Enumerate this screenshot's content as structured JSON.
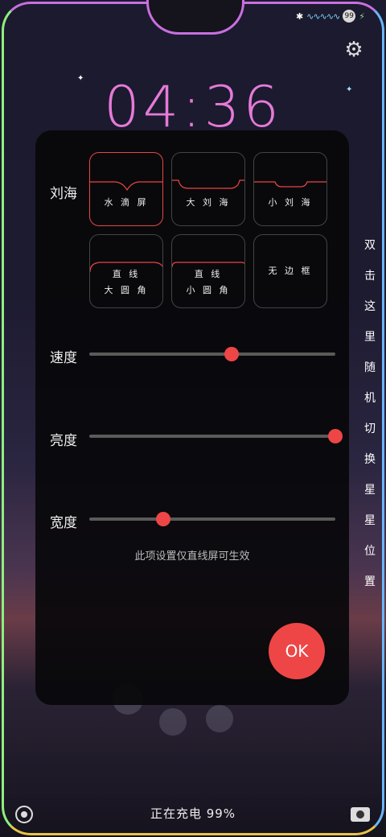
{
  "status_bar": {
    "battery_badge": "99",
    "wave": "∿∿∿∿∿"
  },
  "clock": {
    "time": "04:36"
  },
  "side_hint": [
    "双",
    "击",
    "这",
    "里",
    "随",
    "机",
    "切",
    "换",
    "星",
    "星",
    "位",
    "置"
  ],
  "panel": {
    "notch_label": "刘海",
    "options": [
      {
        "line1": "水 滴 屏",
        "line2": ""
      },
      {
        "line1": "大 刘 海",
        "line2": ""
      },
      {
        "line1": "小 刘 海",
        "line2": ""
      },
      {
        "line1": "直 线",
        "line2": "大 圆 角"
      },
      {
        "line1": "直 线",
        "line2": "小 圆 角"
      },
      {
        "line1": "无 边 框",
        "line2": ""
      }
    ],
    "speed_label": "速度",
    "brightness_label": "亮度",
    "width_label": "宽度",
    "speed_value": 0.58,
    "brightness_value": 1.0,
    "width_value": 0.3,
    "hint": "此项设置仅直线屏可生效",
    "ok_label": "OK"
  },
  "charging_text": "正在充电 99%",
  "colors": {
    "accent": "#ee4646",
    "clock": "#e57ad8"
  },
  "icons": {
    "settings": "gear-icon",
    "bottom_left": "circle-icon",
    "bottom_right": "camera-icon"
  }
}
